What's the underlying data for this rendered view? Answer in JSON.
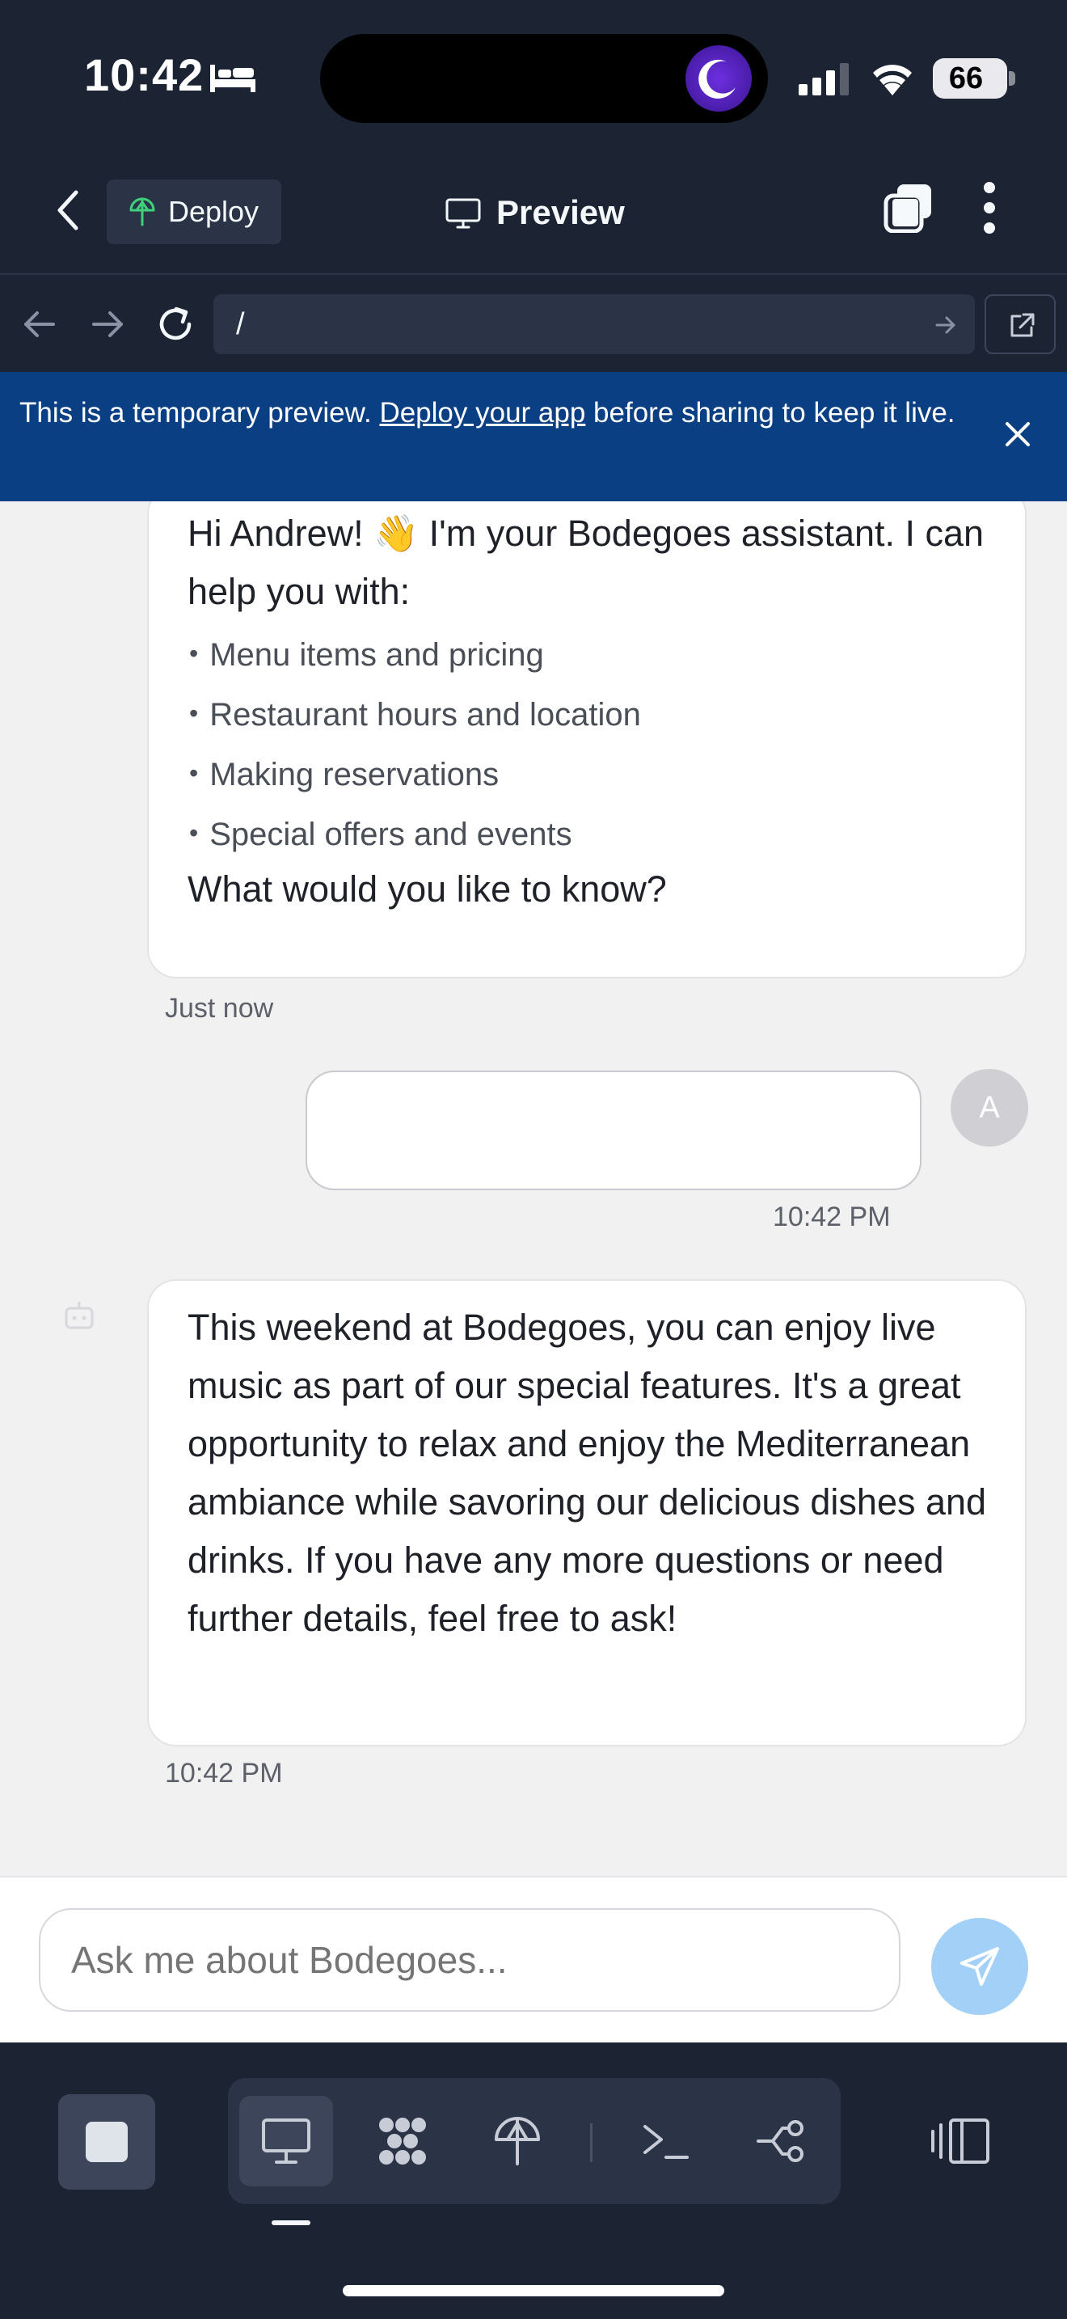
{
  "status_bar": {
    "time": "10:42",
    "battery": "66",
    "icons": [
      "bed-icon",
      "moon-icon",
      "cellular-signal-icon",
      "wifi-icon",
      "battery-icon"
    ]
  },
  "header": {
    "deploy_label": "Deploy",
    "title": "Preview",
    "icons": [
      "back-chevron-icon",
      "deploy-icon",
      "monitor-icon",
      "tabs-icon",
      "more-vertical-icon"
    ]
  },
  "browser": {
    "url": "/",
    "icons": [
      "arrow-left-icon",
      "arrow-right-icon",
      "reload-icon",
      "go-arrow-icon",
      "open-external-icon"
    ]
  },
  "banner": {
    "text_before": "This is a temporary preview. ",
    "link": "Deploy your app",
    "text_after": " before sharing to keep it live.",
    "color": "#0b3f84"
  },
  "chat": {
    "messages": [
      {
        "role": "assistant",
        "intro": "Hi Andrew! 👋 I'm your Bodegoes assistant. I can help you with:",
        "list": [
          "Menu items and pricing",
          "Restaurant hours and location",
          "Making reservations",
          "Special offers and events"
        ],
        "question": "What would you like to know?",
        "timestamp": "Just now"
      },
      {
        "role": "user",
        "text": "",
        "avatar_initial": "A",
        "timestamp": "10:42 PM"
      },
      {
        "role": "assistant",
        "text": "This weekend at Bodegoes, you can enjoy live music as part of our special features. It's a great opportunity to relax and enjoy the Mediterranean ambiance while savoring our delicious dishes and drinks. If you have any more questions or need further details, feel free to ask!",
        "timestamp": "10:42 PM"
      }
    ],
    "input_placeholder": "Ask me about Bodegoes...",
    "send_color": "#a2d0f6"
  },
  "bottom_toolbar": {
    "icons": [
      "stop-icon",
      "monitor-icon",
      "packages-icon",
      "deploy-icon",
      "terminal-icon",
      "git-branch-icon",
      "layout-toggle-icon"
    ],
    "active_tool": "monitor-icon"
  }
}
